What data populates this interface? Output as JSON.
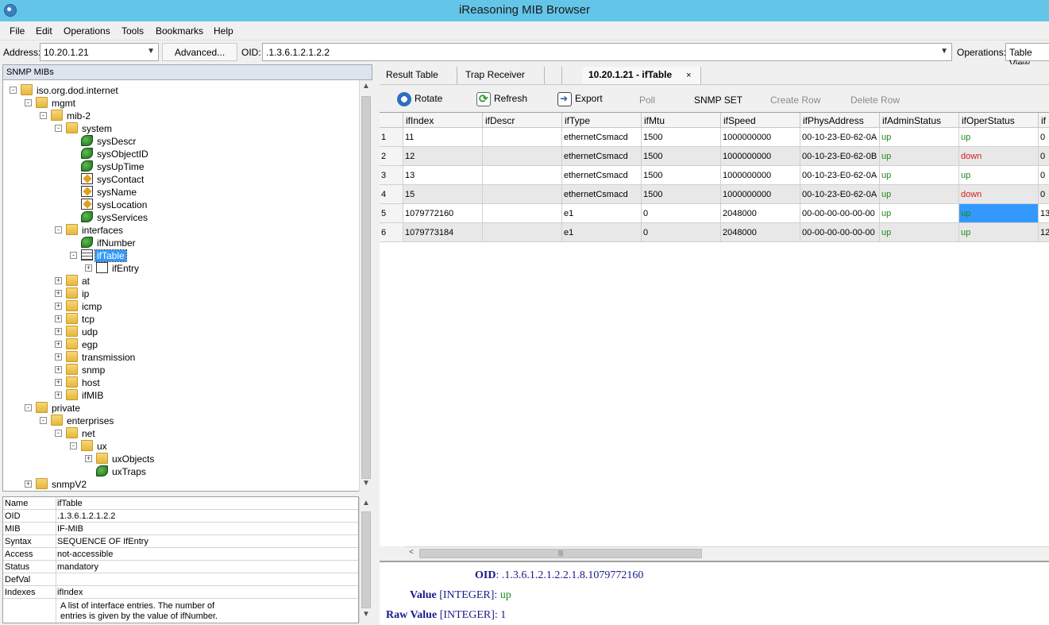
{
  "window": {
    "title": "iReasoning MIB Browser"
  },
  "menu": [
    "File",
    "Edit",
    "Operations",
    "Tools",
    "Bookmarks",
    "Help"
  ],
  "address_bar": {
    "address_label": "Address:",
    "address_value": "10.20.1.21",
    "advanced_label": "Advanced...",
    "oid_label": "OID:",
    "oid_value": ".1.3.6.1.2.1.2.2",
    "operations_label": "Operations:",
    "operations_value": "Table View"
  },
  "left_panel": {
    "header": "SNMP MIBs",
    "tree": [
      {
        "label": "iso.org.dod.internet",
        "depth": 0,
        "toggle": "-",
        "icon": "folder"
      },
      {
        "label": "mgmt",
        "depth": 1,
        "toggle": "-",
        "icon": "folder"
      },
      {
        "label": "mib-2",
        "depth": 2,
        "toggle": "-",
        "icon": "folder"
      },
      {
        "label": "system",
        "depth": 3,
        "toggle": "-",
        "icon": "folder"
      },
      {
        "label": "sysDescr",
        "depth": 4,
        "toggle": "",
        "icon": "leaf"
      },
      {
        "label": "sysObjectID",
        "depth": 4,
        "toggle": "",
        "icon": "leaf"
      },
      {
        "label": "sysUpTime",
        "depth": 4,
        "toggle": "",
        "icon": "leaf"
      },
      {
        "label": "sysContact",
        "depth": 4,
        "toggle": "",
        "icon": "leaf-writable"
      },
      {
        "label": "sysName",
        "depth": 4,
        "toggle": "",
        "icon": "leaf-writable"
      },
      {
        "label": "sysLocation",
        "depth": 4,
        "toggle": "",
        "icon": "leaf-writable"
      },
      {
        "label": "sysServices",
        "depth": 4,
        "toggle": "",
        "icon": "leaf"
      },
      {
        "label": "interfaces",
        "depth": 3,
        "toggle": "-",
        "icon": "folder"
      },
      {
        "label": "ifNumber",
        "depth": 4,
        "toggle": "",
        "icon": "leaf"
      },
      {
        "label": "ifTable",
        "depth": 4,
        "toggle": "-",
        "icon": "table",
        "selected": true
      },
      {
        "label": "ifEntry",
        "depth": 5,
        "toggle": "+",
        "icon": "entry"
      },
      {
        "label": "at",
        "depth": 3,
        "toggle": "+",
        "icon": "folder"
      },
      {
        "label": "ip",
        "depth": 3,
        "toggle": "+",
        "icon": "folder"
      },
      {
        "label": "icmp",
        "depth": 3,
        "toggle": "+",
        "icon": "folder"
      },
      {
        "label": "tcp",
        "depth": 3,
        "toggle": "+",
        "icon": "folder"
      },
      {
        "label": "udp",
        "depth": 3,
        "toggle": "+",
        "icon": "folder"
      },
      {
        "label": "egp",
        "depth": 3,
        "toggle": "+",
        "icon": "folder"
      },
      {
        "label": "transmission",
        "depth": 3,
        "toggle": "+",
        "icon": "folder"
      },
      {
        "label": "snmp",
        "depth": 3,
        "toggle": "+",
        "icon": "folder"
      },
      {
        "label": "host",
        "depth": 3,
        "toggle": "+",
        "icon": "folder"
      },
      {
        "label": "ifMIB",
        "depth": 3,
        "toggle": "+",
        "icon": "folder"
      },
      {
        "label": "private",
        "depth": 1,
        "toggle": "-",
        "icon": "folder"
      },
      {
        "label": "enterprises",
        "depth": 2,
        "toggle": "-",
        "icon": "folder"
      },
      {
        "label": "net",
        "depth": 3,
        "toggle": "-",
        "icon": "folder"
      },
      {
        "label": "ux",
        "depth": 4,
        "toggle": "-",
        "icon": "folder"
      },
      {
        "label": "uxObjects",
        "depth": 5,
        "toggle": "+",
        "icon": "folder"
      },
      {
        "label": "uxTraps",
        "depth": 5,
        "toggle": "",
        "icon": "leaf"
      },
      {
        "label": "snmpV2",
        "depth": 1,
        "toggle": "+",
        "icon": "folder"
      }
    ],
    "properties": [
      {
        "key": "Name",
        "value": "ifTable"
      },
      {
        "key": "OID",
        "value": ".1.3.6.1.2.1.2.2"
      },
      {
        "key": "MIB",
        "value": "IF-MIB"
      },
      {
        "key": "Syntax",
        "value": "SEQUENCE OF IfEntry"
      },
      {
        "key": "Access",
        "value": "not-accessible"
      },
      {
        "key": "Status",
        "value": "mandatory"
      },
      {
        "key": "DefVal",
        "value": ""
      },
      {
        "key": "Indexes",
        "value": "ifIndex"
      }
    ],
    "description_line1": "A list of interface entries.  The number of",
    "description_line2": "entries is given by the value of ifNumber."
  },
  "tabs": [
    "Result Table",
    "Trap Receiver",
    "10.20.1.21 - ifTable"
  ],
  "tab_close": "×",
  "toolbar": [
    "Rotate",
    "Refresh",
    "Export",
    "Poll",
    "SNMP SET",
    "Create Row",
    "Delete Row"
  ],
  "table": {
    "columns": [
      "ifIndex",
      "ifDescr",
      "ifType",
      "ifMtu",
      "ifSpeed",
      "ifPhysAddress",
      "ifAdminStatus",
      "ifOperStatus",
      "if"
    ],
    "rows": [
      [
        "1",
        "11",
        "",
        "ethernetCsmacd",
        "1500",
        "1000000000",
        "00-10-23-E0-62-0A",
        "up",
        "up",
        "0"
      ],
      [
        "2",
        "12",
        "",
        "ethernetCsmacd",
        "1500",
        "1000000000",
        "00-10-23-E0-62-0B",
        "up",
        "down",
        "0"
      ],
      [
        "3",
        "13",
        "",
        "ethernetCsmacd",
        "1500",
        "1000000000",
        "00-10-23-E0-62-0A",
        "up",
        "up",
        "0"
      ],
      [
        "4",
        "15",
        "",
        "ethernetCsmacd",
        "1500",
        "1000000000",
        "00-10-23-E0-62-0A",
        "up",
        "down",
        "0"
      ],
      [
        "5",
        "1079772160",
        "",
        "e1",
        "0",
        "2048000",
        "00-00-00-00-00-00",
        "up",
        "up",
        "13"
      ],
      [
        "6",
        "1079773184",
        "",
        "e1",
        "0",
        "2048000",
        "00-00-00-00-00-00",
        "up",
        "up",
        "12"
      ]
    ]
  },
  "details": {
    "oid_label": "OID",
    "oid_value": ".1.3.6.1.2.1.2.2.1.8.1079772160",
    "value_label": "Value",
    "value_type": "[INTEGER]",
    "value": "up",
    "raw_label": "Raw Value",
    "raw_type": "[INTEGER]",
    "raw_value": "1"
  },
  "colors": {
    "titlebar": "#63c5e8",
    "selection": "#3399ff",
    "status_up": "#1a8a1a",
    "status_down": "#d42020"
  }
}
